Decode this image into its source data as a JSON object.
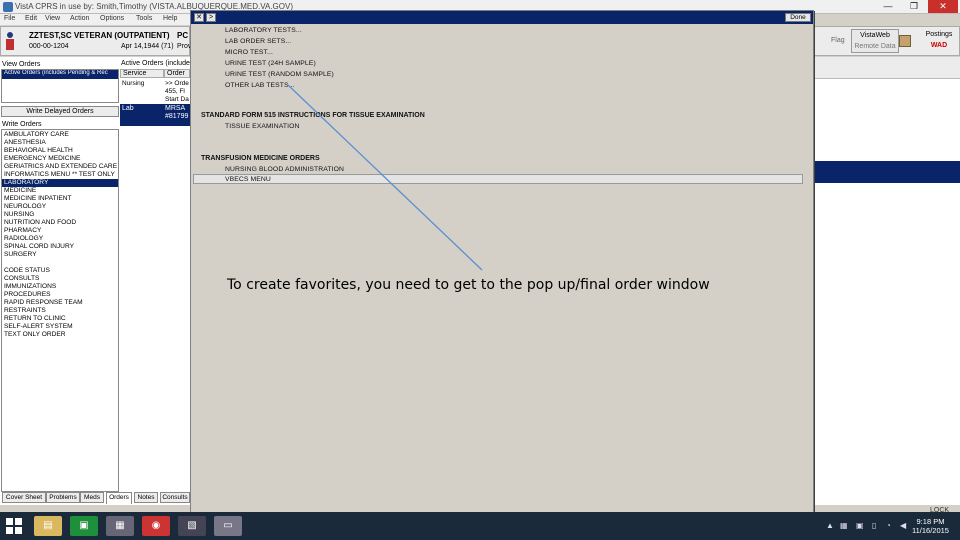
{
  "window": {
    "title": "VistA CPRS in use by: Smith,Timothy (VISTA.ALBUQUERQUE.MED.VA.GOV)",
    "minimize": "—",
    "maximize": "❐",
    "close": "✕"
  },
  "menubar": {
    "items": [
      "File",
      "Edit",
      "View",
      "Action",
      "Options",
      "Tools",
      "Help"
    ]
  },
  "patient": {
    "name": "ZZTEST,SC VETERAN (OUTPATIENT)",
    "ssn": "000-00-1204",
    "dob": "Apr 14,1944 (71)",
    "pc_label": "PC",
    "pc_sub": "Prov"
  },
  "right_toolbar": {
    "flag": "Flag",
    "vistaweb": "VistaWeb",
    "vistaweb_sub": "Remote Data",
    "postings": "Postings",
    "postings_code": "WAD"
  },
  "left": {
    "view_orders_label": "View Orders",
    "view_orders_selected": "Active Orders (includes Pending & Rec",
    "write_delayed": "Write Delayed Orders",
    "write_orders_label": "Write Orders",
    "write_orders": [
      "AMBULATORY CARE",
      "ANESTHESIA",
      "BEHAVIORAL HEALTH",
      "EMERGENCY MEDICINE",
      "GERIATRICS AND EXTENDED CARE",
      "INFORMATICS MENU ** TEST ONLY",
      "LABORATORY",
      "MEDICINE",
      "MEDICINE INPATIENT",
      "NEUROLOGY",
      "NURSING",
      "NUTRITION AND FOOD",
      "PHARMACY",
      "RADIOLOGY",
      "SPINAL CORD INJURY",
      "SURGERY",
      "",
      "CODE STATUS",
      "CONSULTS",
      "IMMUNIZATIONS",
      "PROCEDURES",
      "RAPID RESPONSE TEAM",
      "RESTRAINTS",
      "RETURN TO CLINIC",
      "SELF-ALERT SYSTEM",
      "TEXT ONLY ORDER"
    ],
    "selected_index": 6
  },
  "active_orders": {
    "label": "Active Orders (includes",
    "columns": [
      "Service",
      "Order"
    ],
    "rows": [
      {
        "service": "Nursing",
        "lines": [
          ">> Orde",
          "455, Fl",
          "Start Da"
        ]
      },
      {
        "service": "Lab",
        "lines": [
          "MRSA",
          "#81799"
        ]
      }
    ]
  },
  "tabs": [
    "Cover Sheet",
    "Problems",
    "Meds",
    "Orders",
    "Notes",
    "Consults"
  ],
  "active_tab": 3,
  "status": {
    "lock": "LOCK"
  },
  "dialog": {
    "close": "✕",
    "arrow": ">",
    "done": "Done",
    "lab_items": [
      "LABORATORY TESTS...",
      "LAB ORDER SETS...",
      "MICRO TEST...",
      "URINE TEST (24H SAMPLE)",
      "URINE TEST (RANDOM SAMPLE)",
      "OTHER LAB TESTS..."
    ],
    "section2_head": "STANDARD FORM 515 INSTRUCTIONS FOR TISSUE EXAMINATION",
    "section2_items": [
      "TISSUE EXAMINATION"
    ],
    "section3_head": "TRANSFUSION MEDICINE ORDERS",
    "section3_items": [
      "NURSING BLOOD ADMINISTRATION",
      "VBECS MENU"
    ],
    "annotation": "To create favorites, you need to get to the pop up/final order window"
  },
  "taskbar": {
    "clock_time": "9:18 PM",
    "clock_date": "11/16/2015"
  },
  "colors": {
    "selection": "#0a246a",
    "dialog_bg": "#d4d0c8",
    "annotation_line": "#5b8fd0",
    "taskbar": "#1b2a3a"
  }
}
